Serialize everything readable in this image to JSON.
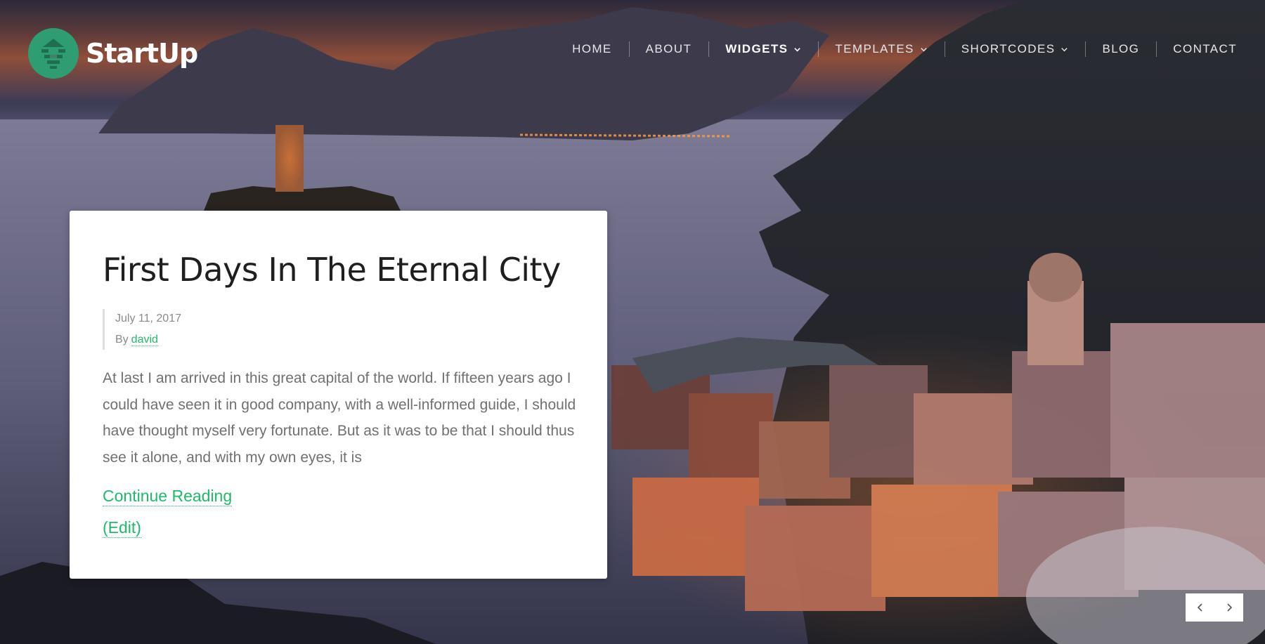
{
  "brand": {
    "name": "StartUp",
    "icon": "stacked-lines-logo-icon",
    "color": "#2e9e72"
  },
  "nav": {
    "items": [
      {
        "label": "HOME",
        "has_dropdown": false,
        "active": false
      },
      {
        "label": "ABOUT",
        "has_dropdown": false,
        "active": false
      },
      {
        "label": "WIDGETS",
        "has_dropdown": true,
        "active": true
      },
      {
        "label": "TEMPLATES",
        "has_dropdown": true,
        "active": false
      },
      {
        "label": "SHORTCODES",
        "has_dropdown": true,
        "active": false
      },
      {
        "label": "BLOG",
        "has_dropdown": false,
        "active": false
      },
      {
        "label": "CONTACT",
        "has_dropdown": false,
        "active": false
      }
    ],
    "dropdown_icon": "chevron-down-icon"
  },
  "post": {
    "title": "First Days In The Eternal City",
    "date": "July 11, 2017",
    "by_label": "By",
    "author": "david",
    "excerpt": "At last I am arrived in this great capital of the world. If fifteen years ago I could have seen it in good company, with a well-informed guide, I should have thought myself very fortunate. But as it was to be that I should thus see it alone, and with my own eyes, it is",
    "continue_label": "Continue Reading",
    "edit_label": "(Edit)"
  },
  "slider": {
    "prev_icon": "chevron-left-icon",
    "next_icon": "chevron-right-icon"
  },
  "colors": {
    "accent": "#1fb96b",
    "title_text": "#1f1f1f",
    "body_text": "#707070",
    "meta_text": "#8a8a8a"
  }
}
